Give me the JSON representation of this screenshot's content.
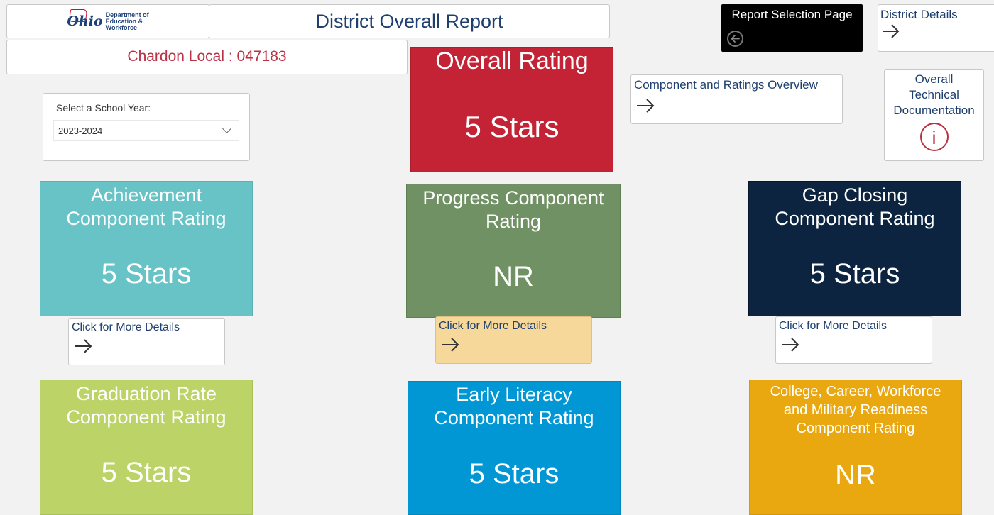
{
  "header": {
    "logo_script": "Ohio",
    "logo_lines": [
      "Department of",
      "Education &",
      "Workforce"
    ],
    "title": "District Overall Report",
    "district": "Chardon Local : 047183"
  },
  "year_selector": {
    "label": "Select a School Year:",
    "selected": "2023-2024"
  },
  "nav": {
    "report_selection": "Report Selection Page",
    "district_details": "District Details",
    "overview": "Component and Ratings Overview",
    "tech_doc_lines": [
      "Overall",
      "Technical",
      "Documentation"
    ]
  },
  "overall": {
    "title": "Overall Rating",
    "value": "5 Stars"
  },
  "components": {
    "achievement": {
      "title_lines": [
        "Achievement",
        "Component Rating"
      ],
      "value": "5 Stars",
      "details": "Click for More Details"
    },
    "progress": {
      "title_lines": [
        "Progress Component",
        "Rating"
      ],
      "value": "NR",
      "details": "Click for More Details"
    },
    "gap_closing": {
      "title_lines": [
        "Gap Closing",
        "Component Rating"
      ],
      "value": "5 Stars",
      "details": "Click for More Details"
    },
    "graduation": {
      "title_lines": [
        "Graduation Rate",
        "Component Rating"
      ],
      "value": "5 Stars"
    },
    "early_literacy": {
      "title_lines": [
        "Early Literacy",
        "Component Rating"
      ],
      "value": "5 Stars"
    },
    "ccw": {
      "title_lines": [
        "College, Career, Workforce",
        "and Military Readiness",
        "Component Rating"
      ],
      "value": "NR"
    }
  },
  "colors": {
    "overall": "#c32335",
    "achievement": "#68c3c7",
    "progress": "#709163",
    "gap_closing": "#0d2440",
    "graduation": "#bcd368",
    "early_literacy": "#0197d5",
    "ccw": "#e9a710",
    "progress_details_bg": "#f6d89b",
    "title_text": "#1f3f6e",
    "district_text": "#b83243"
  },
  "icons": {
    "back": "circle-arrow-left-icon",
    "arrow": "arrow-right-icon",
    "info": "info-circle-icon",
    "chevron": "chevron-down-icon"
  }
}
